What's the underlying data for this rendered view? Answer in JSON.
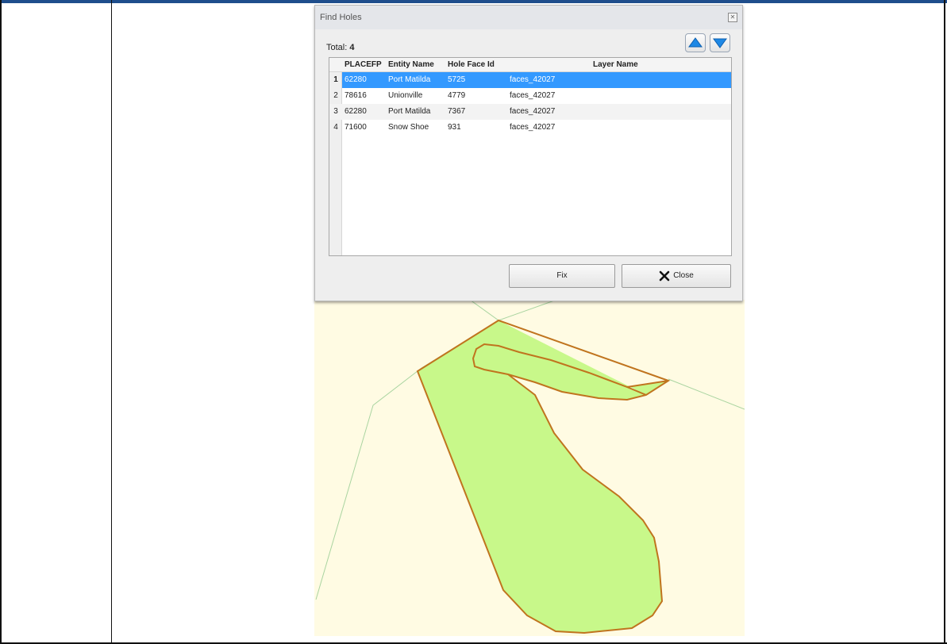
{
  "dialog": {
    "title": "Find Holes",
    "total_label": "Total: ",
    "total_value": "4",
    "columns": [
      "PLACEFP",
      "Entity Name",
      "Hole Face Id",
      "Layer Name"
    ],
    "rows": [
      {
        "num": "1",
        "placefp": "62280",
        "entity": "Port Matilda",
        "hole": "5725",
        "layer": "faces_42027"
      },
      {
        "num": "2",
        "placefp": "78616",
        "entity": "Unionville",
        "hole": "4779",
        "layer": "faces_42027"
      },
      {
        "num": "3",
        "placefp": "62280",
        "entity": "Port Matilda",
        "hole": "7367",
        "layer": "faces_42027"
      },
      {
        "num": "4",
        "placefp": "71600",
        "entity": "Snow Shoe",
        "hole": "931",
        "layer": "faces_42027"
      }
    ],
    "selected_row": 1,
    "fix_label": "Fix",
    "close_label": "Close"
  },
  "colors": {
    "selection": "#3399ff",
    "polygon_fill": "#c8f88a",
    "polygon_stroke": "#c0741e",
    "map_background": "#fffbe3",
    "boundary_line": "#a9d4a0",
    "frame_top": "#1f4e8c"
  }
}
